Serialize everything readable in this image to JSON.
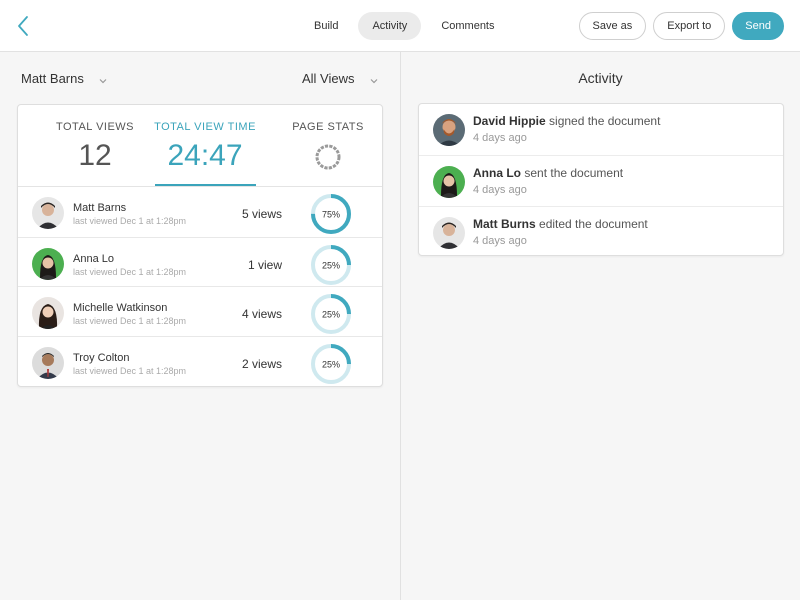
{
  "header": {
    "tabs": [
      {
        "label": "Build",
        "active": false
      },
      {
        "label": "Activity",
        "active": true
      },
      {
        "label": "Comments",
        "active": false
      }
    ],
    "buttons": {
      "save_as": "Save as",
      "export_to": "Export to",
      "send": "Send"
    },
    "accent_color": "#40a9bf"
  },
  "filters": {
    "person": "Matt Barns",
    "views": "All Views"
  },
  "stats": {
    "total_views_label": "TOTAL VIEWS",
    "total_views_value": "12",
    "total_view_time_label": "TOTAL VIEW TIME",
    "total_view_time_value": "24:47",
    "page_stats_label": "PAGE STATS"
  },
  "viewers": [
    {
      "name": "Matt Barns",
      "last_viewed": "last viewed Dec 1 at 1:28pm",
      "views": "5 views",
      "percent_label": "75%",
      "percent": 0.75,
      "avatar": "avatar-man-dark-hair"
    },
    {
      "name": "Anna Lo",
      "last_viewed": "last viewed Dec 1 at 1:28pm",
      "views": "1 view",
      "percent_label": "25%",
      "percent": 0.25,
      "avatar": "avatar-woman-green-bg"
    },
    {
      "name": "Michelle Watkinson",
      "last_viewed": "last viewed Dec 1 at 1:28pm",
      "views": "4 views",
      "percent_label": "25%",
      "percent": 0.25,
      "avatar": "avatar-woman-dark-hair"
    },
    {
      "name": "Troy Colton",
      "last_viewed": "last viewed Dec 1 at 1:28pm",
      "views": "2 views",
      "percent_label": "25%",
      "percent": 0.25,
      "avatar": "avatar-man-suit"
    }
  ],
  "activity": {
    "title": "Activity",
    "items": [
      {
        "actor": "David Hippie",
        "action": "signed the document",
        "time": "4 days ago",
        "avatar": "avatar-man-beard"
      },
      {
        "actor": "Anna Lo",
        "action": "sent the document",
        "time": "4 days ago",
        "avatar": "avatar-woman-green-bg"
      },
      {
        "actor": "Matt Burns",
        "action": "edited the document",
        "time": "4 days ago",
        "avatar": "avatar-man-dark-hair"
      }
    ]
  }
}
